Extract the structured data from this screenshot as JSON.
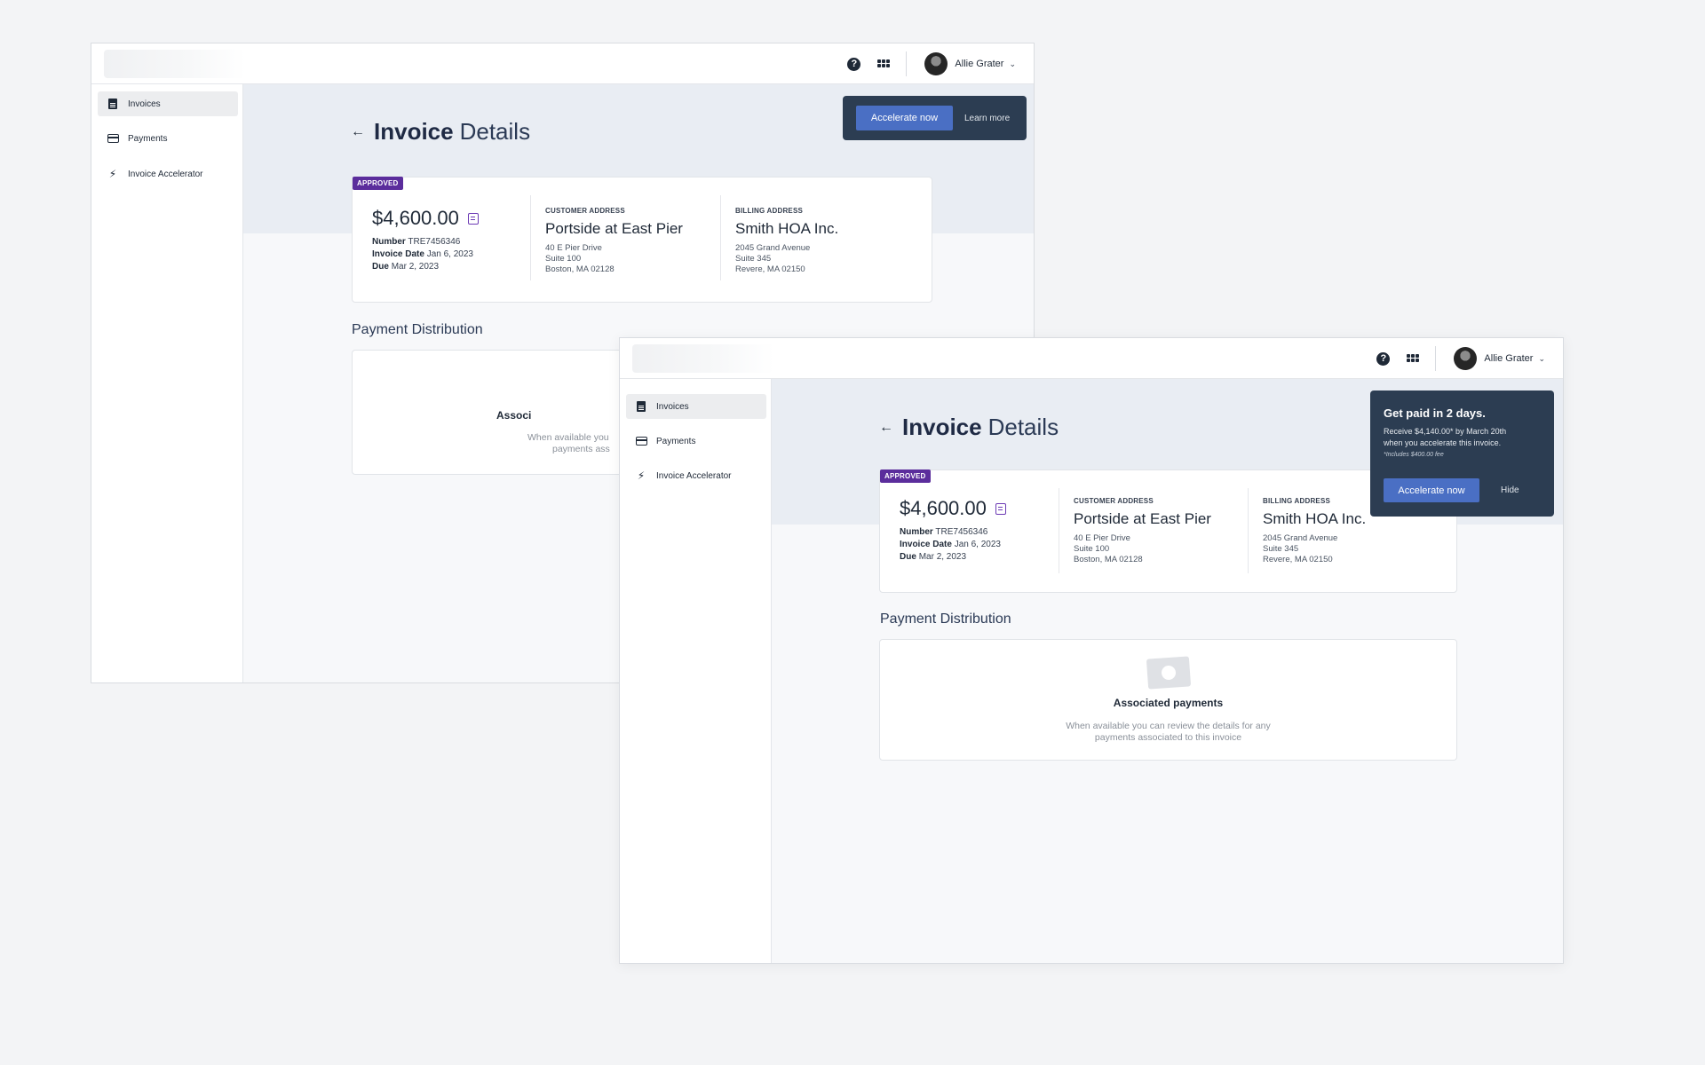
{
  "app": {
    "user_name": "Allie Grater",
    "help_icon": "help-circle-icon",
    "apps_icon": "apps-grid-icon"
  },
  "sidebar": {
    "items": [
      {
        "label": "Invoices",
        "icon": "document-icon"
      },
      {
        "label": "Payments",
        "icon": "credit-card-icon"
      },
      {
        "label": "Invoice Accelerator",
        "icon": "lightning-bolt-icon"
      }
    ]
  },
  "page": {
    "title_bold": "Invoice",
    "title_light": "Details"
  },
  "invoice": {
    "status": "APPROVED",
    "amount": "$4,600.00",
    "number_label": "Number",
    "number": "TRE7456346",
    "date_label": "Invoice Date",
    "date": "Jan 6, 2023",
    "due_label": "Due",
    "due": "Mar 2, 2023",
    "customer": {
      "label": "CUSTOMER ADDRESS",
      "name": "Portside at East Pier",
      "line1": "40 E Pier Drive",
      "line2": "Suite 100",
      "line3": "Boston, MA 02128"
    },
    "billing": {
      "label": "BILLING ADDRESS",
      "name": "Smith HOA Inc.",
      "line1": "2045 Grand Avenue",
      "line2": "Suite 345",
      "line3": "Revere, MA 02150"
    }
  },
  "payments": {
    "section_title": "Payment Distribution",
    "empty_title": "Associated payments",
    "empty_line1": "When available you can review the details for any",
    "empty_line2": "payments associated to this invoice",
    "clipped_title": "Associ",
    "clipped_line1": "When available you",
    "clipped_line2": "payments ass"
  },
  "banner": {
    "accelerate_label": "Accelerate now",
    "learn_more_label": "Learn more"
  },
  "promo": {
    "title": "Get paid in 2 days.",
    "body_line1": "Receive $4,140.00* by March 20th",
    "body_line2": "when you accelerate this invoice.",
    "footnote": "*Includes $400.00 fee",
    "accelerate_label": "Accelerate now",
    "hide_label": "Hide"
  },
  "colors": {
    "accent": "#4a6fc4",
    "banner_bg": "#2c3d52",
    "badge": "#5b2d9c"
  }
}
